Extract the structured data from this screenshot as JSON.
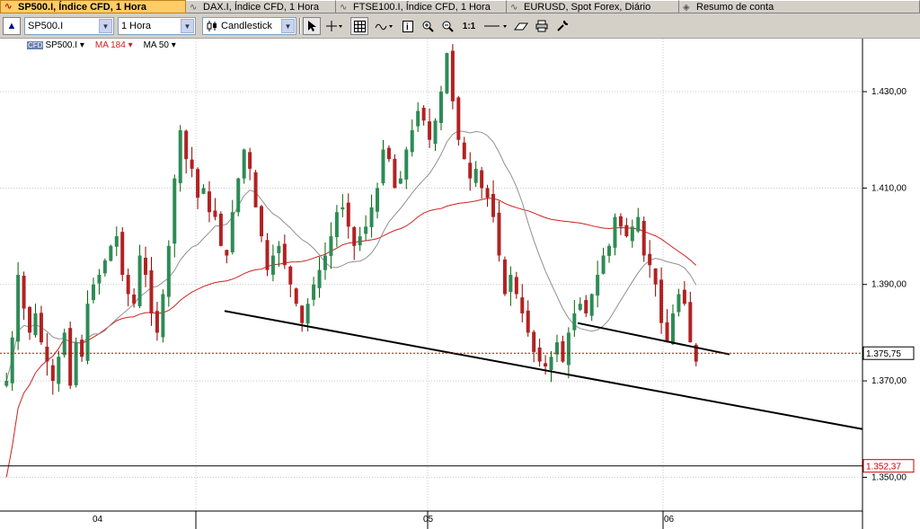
{
  "tabs": [
    {
      "label": "SP500.I, Índice CFD, 1 Hora",
      "active": true,
      "icon": "chart-up-icon"
    },
    {
      "label": "DAX.I, Índice CFD, 1 Hora",
      "active": false,
      "icon": "chart-icon"
    },
    {
      "label": "FTSE100.I, Índice CFD, 1 Hora",
      "active": false,
      "icon": "chart-icon"
    },
    {
      "label": "EURUSD, Spot Forex, Diário",
      "active": false,
      "icon": "chart-icon"
    },
    {
      "label": "Resumo de conta",
      "active": false,
      "icon": "account-icon"
    }
  ],
  "toolbar": {
    "instrument": "SP500.I",
    "timeframe": "1 Hora",
    "chart_type": "Candlestick",
    "zoom_label": "1:1"
  },
  "legend": {
    "instrument": "SP500.I",
    "ma184": "MA 184",
    "ma50": "MA 50",
    "cfd_badge": "CFD",
    "ma184_color": "#d02020"
  },
  "chart_data": {
    "type": "candlestick",
    "instrument": "SP500.I",
    "timeframe": "1 Hora",
    "ylim": [
      1343,
      1441
    ],
    "y_ticks": [
      "1.430,00",
      "1.410,00",
      "1.390,00",
      "1.370,00",
      "1.350,00"
    ],
    "y_tick_values": [
      1430,
      1410,
      1390,
      1370,
      1350
    ],
    "x_labels": [
      "04",
      "05",
      "06"
    ],
    "current_price": "1.375,75",
    "current_price_value": 1375.75,
    "horizontal_level": "1.352,37",
    "horizontal_level_value": 1352.37,
    "close_series": [
      1370,
      1379,
      1392,
      1385,
      1380,
      1384,
      1378,
      1374,
      1370,
      1375,
      1380,
      1369,
      1378,
      1375,
      1386,
      1390,
      1392,
      1395,
      1398,
      1400,
      1392,
      1388,
      1386,
      1396,
      1392,
      1384,
      1380,
      1388,
      1398,
      1412,
      1422,
      1416,
      1414,
      1408,
      1410,
      1405,
      1404,
      1398,
      1396,
      1405,
      1412,
      1418,
      1414,
      1406,
      1400,
      1393,
      1396,
      1398,
      1394,
      1390,
      1386,
      1382,
      1386,
      1390,
      1393,
      1396,
      1400,
      1405,
      1406,
      1402,
      1398,
      1400,
      1402,
      1406,
      1410,
      1418,
      1416,
      1410,
      1412,
      1418,
      1422,
      1426,
      1424,
      1420,
      1424,
      1430,
      1438,
      1428,
      1420,
      1416,
      1412,
      1414,
      1410,
      1408,
      1404,
      1396,
      1388,
      1392,
      1388,
      1384,
      1380,
      1376,
      1374,
      1373,
      1375,
      1378,
      1374,
      1380,
      1384,
      1386,
      1384,
      1388,
      1392,
      1396,
      1398,
      1404,
      1402,
      1400,
      1402,
      1404,
      1396,
      1394,
      1390,
      1382,
      1378,
      1384,
      1388,
      1386,
      1378,
      1374
    ],
    "ma50_color": "#909090",
    "ma184_series_color": "#d02020",
    "price_line_color": "#cc0000"
  }
}
